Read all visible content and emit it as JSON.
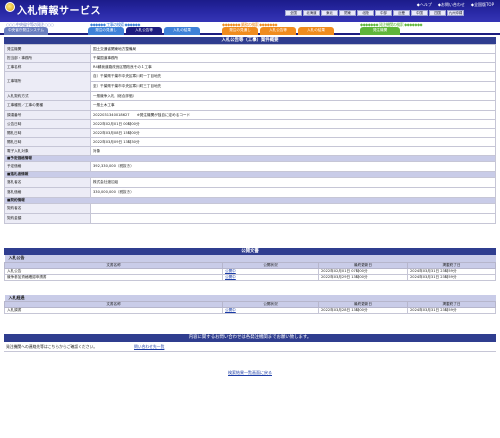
{
  "header": {
    "title": "入札情報サービス",
    "links": [
      "◆ヘルプ",
      "◆お問い合わせ",
      "◆全国版TOP"
    ],
    "regions": [
      "全国",
      "北海道",
      "東北",
      "関東",
      "北陸",
      "中部",
      "近畿",
      "中国",
      "四国",
      "九州沖縄"
    ]
  },
  "groups": {
    "g1": "○○○ 中央省庁等の発注 ○○○",
    "g2": "◆◆◆◆◆◆ 工事の検索 ◆◆◆◆◆◆",
    "g3": "◆◆◆◆◆◆◆ 業務の検索 ◆◆◆◆◆◆◆",
    "g4": "◆◆◆◆◆◆◆ 発注機関の検索 ◆◆◆◆◆◆◆"
  },
  "tabs": [
    "中央省庁発注システム",
    "発注の見通し",
    "入札公告等",
    "入札の結果",
    "発注の見通し",
    "入札公告等",
    "入札の結果",
    "発注機関"
  ],
  "notice": {
    "title": "入札公告等（工事）案件概要",
    "rows": [
      [
        "発注機関",
        "国土交通省関東地方整備局"
      ],
      [
        "担当部・事務所",
        "千葉国道事務所"
      ],
      [
        "工事名称",
        "R4蘇我道路改良区間改良その１工事"
      ],
      [
        "工事場所",
        "自）千葉県千葉市中央区寒川町一丁目地先"
      ],
      [
        "",
        "至）千葉県千葉市中央区寒川町三丁目地先"
      ],
      [
        "入札契約方式",
        "一般競争入札（総合評価）"
      ],
      [
        "工事種別／工事の業種",
        "一般土木工事"
      ],
      [
        "調達番号",
        "2022031340018627　　※発注機関が独自に定めるコード"
      ],
      [
        "公告日時",
        "2022年02月01日 00時00分"
      ],
      [
        "開札日時",
        "2022年03月08日 15時00分"
      ],
      [
        "開札日時",
        "2022年03月09日 13時30分"
      ],
      [
        "電子入札対象",
        "対象"
      ]
    ],
    "sec_estimate": "■予定価格情報",
    "estimate_label": "予定価格",
    "estimate_value": "392,330,000（税抜き）",
    "sec_award": "■落札者情報",
    "award_name_label": "落札者名",
    "award_name_value": "株式会社渡辺組",
    "award_price_label": "落札価格",
    "award_price_value": "330,000,000（税抜き）",
    "sec_contract": "■契約情報",
    "contract_rows": [
      "契約者名",
      "契約金額"
    ]
  },
  "docs": {
    "title": "公開文書",
    "headers": [
      "文書名称",
      "公開状況",
      "最終更新日",
      "掲載終了日"
    ],
    "sec1": "入札公告",
    "rows1": [
      [
        "入札公告",
        "公開中",
        "2022年02月01日 07時00分",
        "2024年03月31日 23時59分"
      ],
      [
        "競争参加資格確認申請書",
        "公開中",
        "2022年03月29日 13時00分",
        "2024年03月31日 23時59分"
      ]
    ],
    "sec2": "入札経過",
    "rows2": [
      [
        "入札調書",
        "公開中",
        "2022年03月28日 13時00分",
        "2024年03月31日 23時59分"
      ]
    ]
  },
  "inquiry": {
    "title": "内容に関するお問い合わせは各発注機関までお願い致します。",
    "text": "発注機関への連絡先等はこちらからご確認ください。",
    "link": "問い合わせ先一覧"
  },
  "footer": {
    "back": "検索結果一覧画面に戻る"
  },
  "colors": {
    "navy": "#2f3d8f",
    "header": "#1b1b8a",
    "section": "#c9cce8"
  }
}
